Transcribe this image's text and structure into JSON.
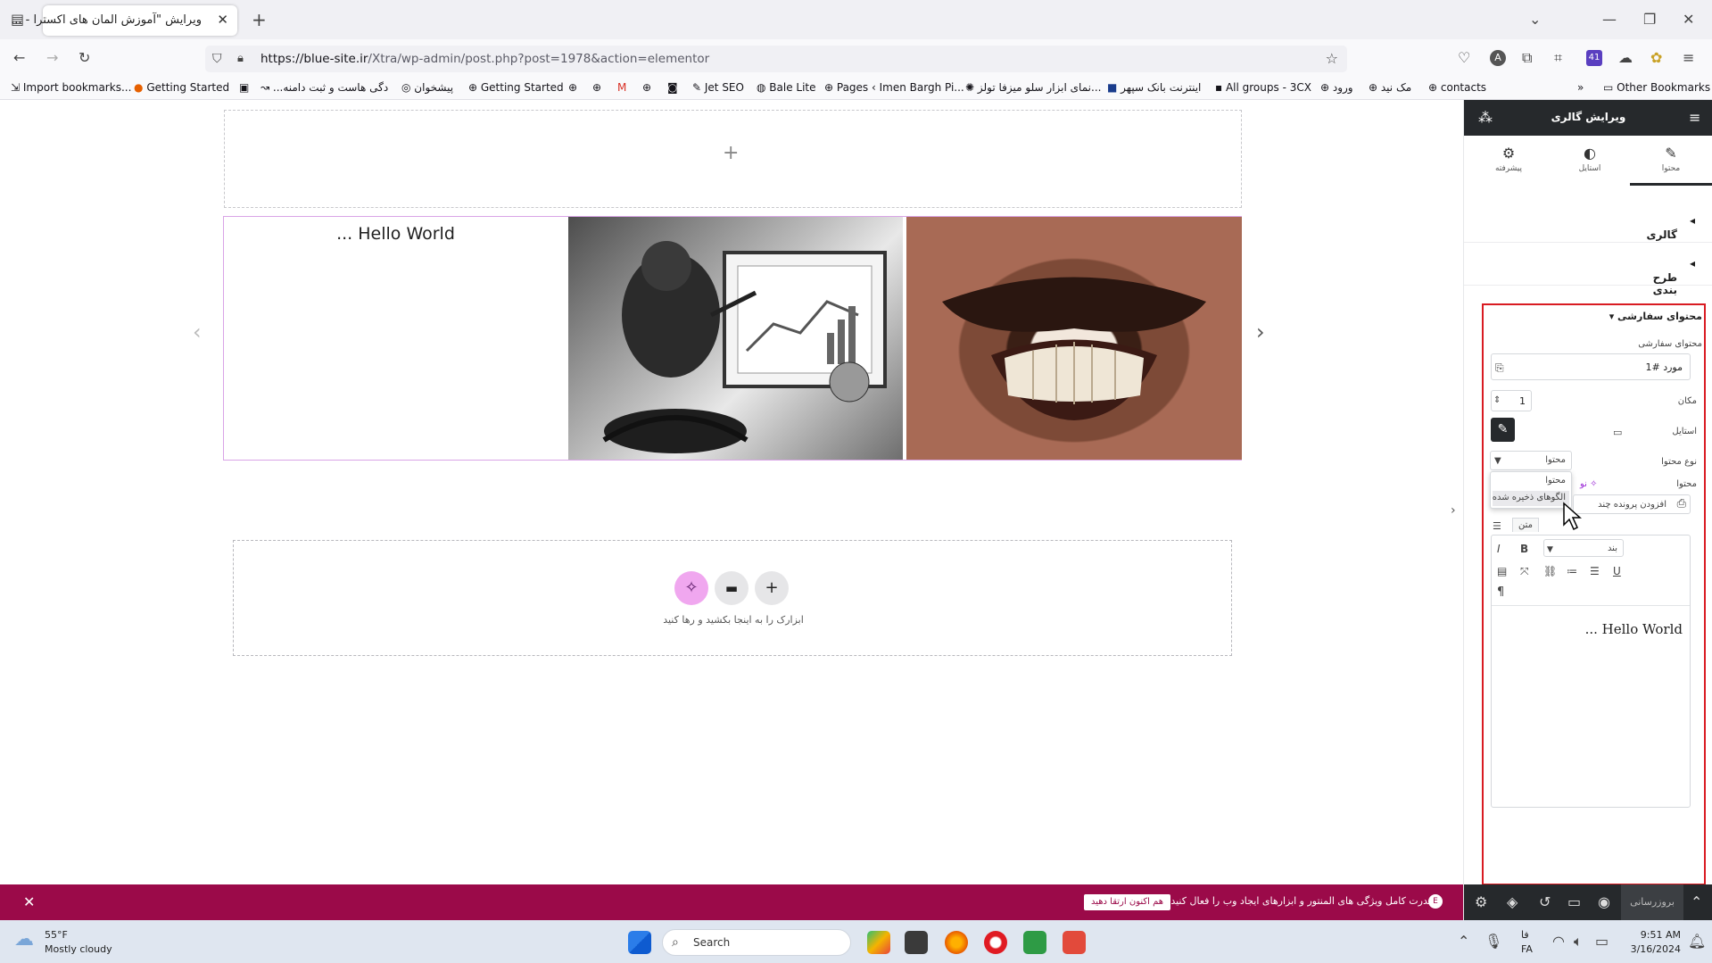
{
  "browser": {
    "tab_title": "ویرایش \"آموزش المان های اکسترا - ...",
    "url_base": "https://blue-site.ir",
    "url_path": "/Xtra/wp-admin/post.php?post=1978&action=elementor",
    "ext_badge": "41",
    "bookmarks": [
      {
        "label": "Import bookmarks..."
      },
      {
        "label": "Getting Started"
      },
      {
        "label": "دگی هاست و ثبت دامنه..."
      },
      {
        "label": "پیشخوان"
      },
      {
        "label": "Getting Started"
      },
      {
        "label": "Jet SEO"
      },
      {
        "label": "Bale Lite"
      },
      {
        "label": "Pages ‹ Imen Bargh Pi..."
      },
      {
        "label": "نمای ابزار سلو میزفا تولز..."
      },
      {
        "label": "اینترنت بانک سپهر"
      },
      {
        "label": "All groups - 3CX"
      },
      {
        "label": "ورود"
      },
      {
        "label": "مک نید"
      },
      {
        "label": "contacts"
      }
    ],
    "other_bookmarks": "Other Bookmarks"
  },
  "canvas": {
    "gallery_text": "... Hello World",
    "drop_hint": "ابزارک را به اینجا بکشید و رها کنید"
  },
  "notice": {
    "message": "قدرت کامل ویژگی های المنتور و ابزارهای ایجاد وب را فعال کنید.",
    "cta": "هم اکنون ارتقا دهید"
  },
  "panel": {
    "title": "ویرایش گالری",
    "tabs": [
      {
        "label": "محتوا",
        "icon": "pencil-icon"
      },
      {
        "label": "استایل",
        "icon": "contrast-icon"
      },
      {
        "label": "پیشرفته",
        "icon": "gear-icon"
      }
    ],
    "sections": [
      "گالری",
      "طرح بندی"
    ],
    "custom_section": "محتوای سفارشی",
    "custom_label": "محتوای سفارشی",
    "item_title": "مورد #1",
    "position_label": "مکان",
    "position_value": "1",
    "style_label": "استایل",
    "content_type_label": "نوع محتوا",
    "content_type_value": "محتوا",
    "dropdown_options": [
      "محتوا",
      "الگوهای ذخیره شده"
    ],
    "content_label": "محتوا",
    "ai_label": "نو",
    "add_media": "افزودن پرونده چند",
    "visual_tab": "متن",
    "format_select": "بند",
    "editor_text": "... Hello World",
    "footer_update": "بروزرسانی"
  },
  "taskbar": {
    "weather_temp": "55°F",
    "weather_desc": "Mostly cloudy",
    "search_placeholder": "Search",
    "lang_top": "فا",
    "lang_bottom": "FA",
    "time": "9:51 AM",
    "date": "3/16/2024"
  }
}
